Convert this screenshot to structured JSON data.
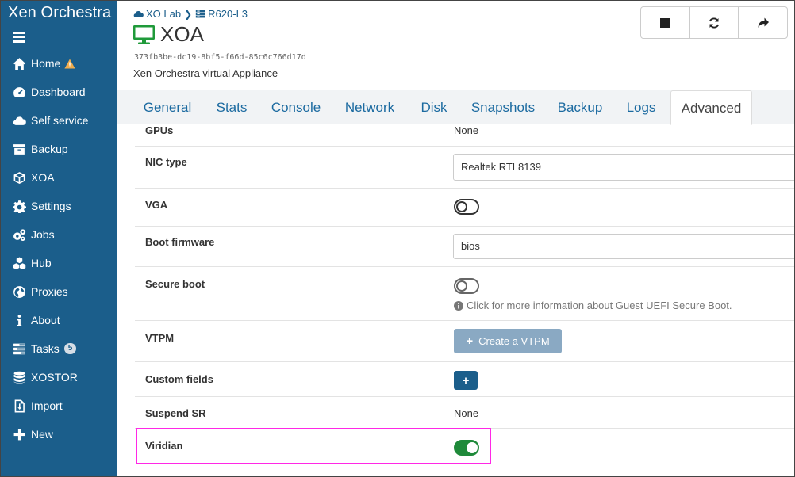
{
  "app": {
    "brand": "Xen Orchestra"
  },
  "sidebar": {
    "items": [
      {
        "label": "Home",
        "icon": "home-icon",
        "warning": true
      },
      {
        "label": "Dashboard",
        "icon": "dashboard-icon"
      },
      {
        "label": "Self service",
        "icon": "cloud-icon"
      },
      {
        "label": "Backup",
        "icon": "archive-icon"
      },
      {
        "label": "XOA",
        "icon": "cube-icon"
      },
      {
        "label": "Settings",
        "icon": "gear-icon"
      },
      {
        "label": "Jobs",
        "icon": "gears-icon"
      },
      {
        "label": "Hub",
        "icon": "cubes-icon"
      },
      {
        "label": "Proxies",
        "icon": "globe-icon"
      },
      {
        "label": "About",
        "icon": "info-icon"
      },
      {
        "label": "Tasks",
        "icon": "tasks-icon",
        "badge": "5"
      },
      {
        "label": "XOSTOR",
        "icon": "database-icon"
      },
      {
        "label": "Import",
        "icon": "file-import-icon"
      },
      {
        "label": "New",
        "icon": "plus-icon"
      }
    ]
  },
  "header": {
    "breadcrumb": {
      "pool": "XO Lab",
      "host": "R620-L3"
    },
    "vm_name": "XOA",
    "uuid": "373fb3be-dc19-8bf5-f66d-85c6c766d17d",
    "description": "Xen Orchestra virtual Appliance"
  },
  "tabs": [
    "General",
    "Stats",
    "Console",
    "Network",
    "Disk",
    "Snapshots",
    "Backup",
    "Logs",
    "Advanced"
  ],
  "active_tab": "Advanced",
  "advanced": {
    "gpus": {
      "label": "GPUs",
      "value": "None"
    },
    "nic_type": {
      "label": "NIC type",
      "value": "Realtek RTL8139"
    },
    "vga": {
      "label": "VGA",
      "enabled": false
    },
    "boot_firmware": {
      "label": "Boot firmware",
      "value": "bios"
    },
    "secure_boot": {
      "label": "Secure boot",
      "enabled": false,
      "info": "Click for more information about Guest UEFI Secure Boot."
    },
    "vtpm": {
      "label": "VTPM",
      "button": "Create a VTPM"
    },
    "custom_fields": {
      "label": "Custom fields",
      "button": "+"
    },
    "suspend_sr": {
      "label": "Suspend SR",
      "value": "None"
    },
    "viridian": {
      "label": "Viridian",
      "enabled": true
    }
  },
  "colors": {
    "sidebar": "#1b5e8b",
    "accent": "#1b6aa0",
    "toggle_on": "#1f8a3a",
    "highlight": "#ff28e6",
    "vm_running": "#1f9a3a"
  }
}
